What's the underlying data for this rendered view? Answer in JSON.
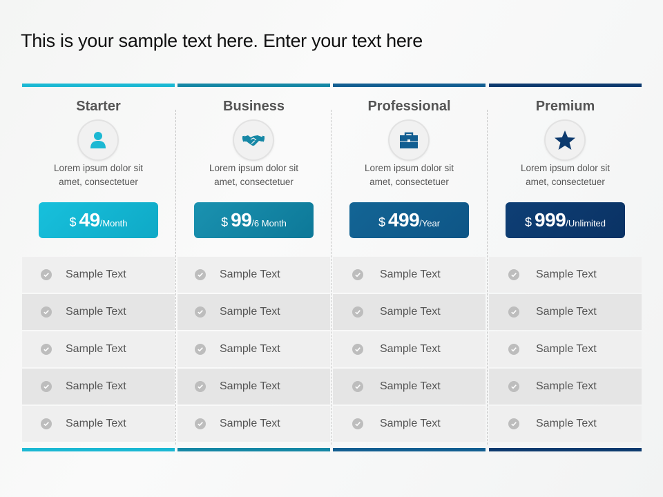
{
  "title": "This is your sample text here. Enter your text here",
  "plans": [
    {
      "name": "Starter",
      "icon": "user-icon",
      "description_line1": "Lorem ipsum dolor sit",
      "description_line2": "amet, consectetuer",
      "currency": "$",
      "price": "49",
      "period": "/Month",
      "color": "#1bb8d3",
      "button_color_from": "#17c0dc",
      "button_color_to": "#0fa9c6",
      "features": [
        "Sample Text",
        "Sample Text",
        "Sample Text",
        "Sample Text",
        "Sample Text"
      ]
    },
    {
      "name": "Business",
      "icon": "handshake-icon",
      "description_line1": "Lorem ipsum dolor sit",
      "description_line2": "amet, consectetuer",
      "currency": "$",
      "price": "99",
      "period": "/6 Month",
      "color": "#1587a5",
      "button_color_from": "#1a92b0",
      "button_color_to": "#0d7898",
      "features": [
        "Sample Text",
        "Sample Text",
        "Sample Text",
        "Sample Text",
        "Sample Text"
      ]
    },
    {
      "name": "Professional",
      "icon": "briefcase-icon",
      "description_line1": "Lorem ipsum dolor sit",
      "description_line2": "amet, consectetuer",
      "currency": "$",
      "price": "499",
      "period": "/Year",
      "color": "#125e91",
      "button_color_from": "#136595",
      "button_color_to": "#0e5586",
      "features": [
        "Sample Text",
        "Sample Text",
        "Sample Text",
        "Sample Text",
        "Sample Text"
      ]
    },
    {
      "name": "Premium",
      "icon": "star-icon",
      "description_line1": "Lorem ipsum dolor sit",
      "description_line2": "amet, consectetuer",
      "currency": "$",
      "price": "999",
      "period": "/Unlimited",
      "color": "#0d3a6e",
      "button_color_from": "#0e3f75",
      "button_color_to": "#0a3264",
      "features": [
        "Sample Text",
        "Sample Text",
        "Sample Text",
        "Sample Text",
        "Sample Text"
      ]
    }
  ],
  "check_icon": "check-circle-icon"
}
